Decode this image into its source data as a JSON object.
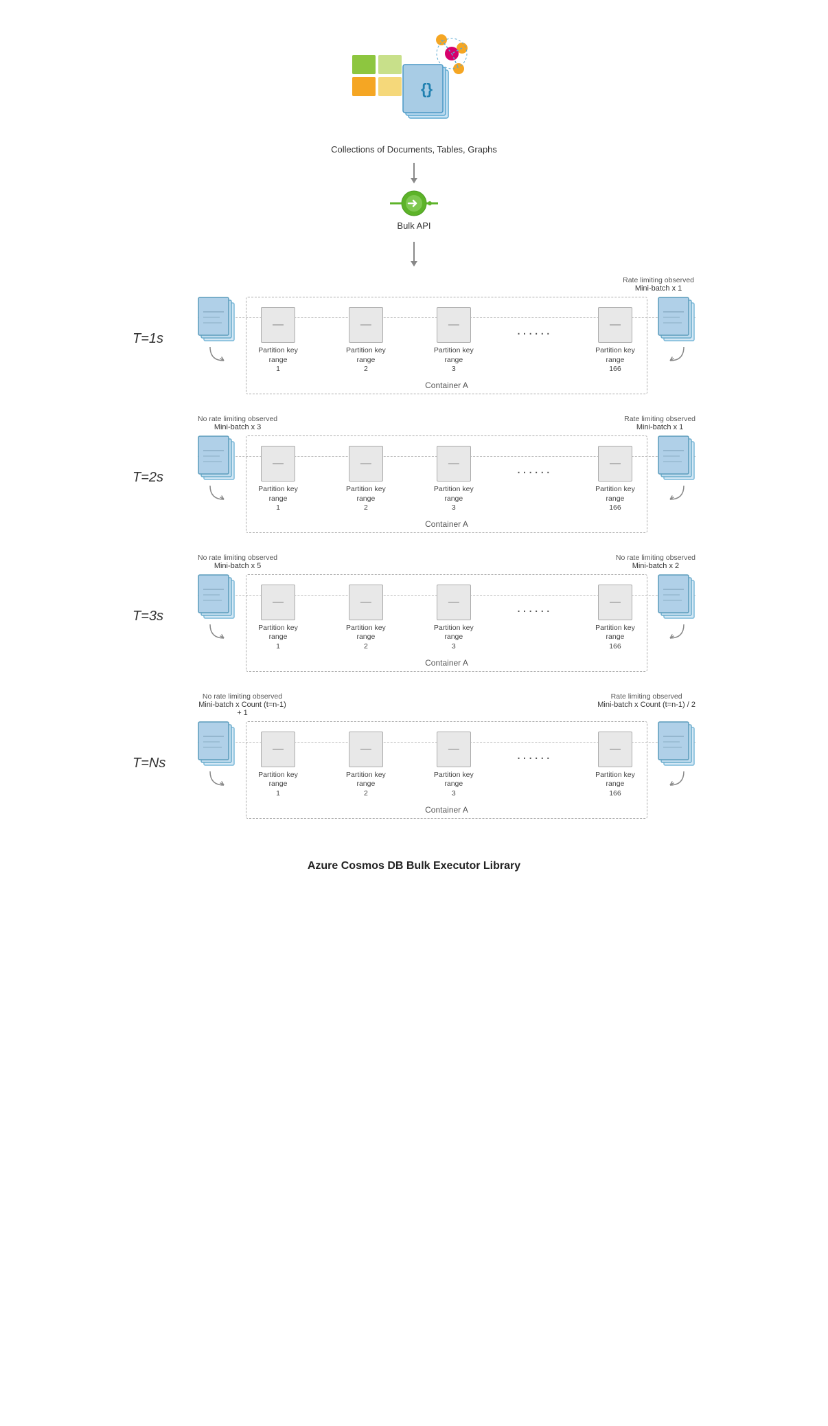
{
  "page": {
    "title": "Azure Cosmos DB Bulk Executor Library",
    "top_caption": "Collections of Documents, Tables, Graphs",
    "bulk_api_label": "Bulk API",
    "container_label": "Container A",
    "ellipsis": "......",
    "sections": [
      {
        "id": "t1",
        "time_label": "T=1s",
        "left_note": null,
        "left_batch": null,
        "right_note": "Rate limiting observed",
        "right_batch": "Mini-batch x 1",
        "partitions": [
          {
            "label": "Partition key range 1"
          },
          {
            "label": "Partition key range 2"
          },
          {
            "label": "Partition key range 3"
          },
          {
            "label": "Partition key range 166"
          }
        ]
      },
      {
        "id": "t2",
        "time_label": "T=2s",
        "left_note": "No rate limiting observed",
        "left_batch": "Mini-batch x 3",
        "right_note": "Rate limiting observed",
        "right_batch": "Mini-batch x 1",
        "partitions": [
          {
            "label": "Partition key range 1"
          },
          {
            "label": "Partition key range 2"
          },
          {
            "label": "Partition key range 3"
          },
          {
            "label": "Partition key range 166"
          }
        ]
      },
      {
        "id": "t3",
        "time_label": "T=3s",
        "left_note": "No rate limiting observed",
        "left_batch": "Mini-batch x 5",
        "right_note": "No rate limiting observed",
        "right_batch": "Mini-batch x 2",
        "partitions": [
          {
            "label": "Partition key range 1"
          },
          {
            "label": "Partition key range 2"
          },
          {
            "label": "Partition key range 3"
          },
          {
            "label": "Partition key range 166"
          }
        ]
      },
      {
        "id": "tN",
        "time_label": "T=Ns",
        "left_note": "No rate limiting observed",
        "left_batch": "Mini-batch x Count (t=n-1) + 1",
        "right_note": "Rate limiting observed",
        "right_batch": "Mini-batch x Count (t=n-1) / 2",
        "partitions": [
          {
            "label": "Partition key range 1"
          },
          {
            "label": "Partition key range 2"
          },
          {
            "label": "Partition key range 3"
          },
          {
            "label": "Partition key range 166"
          }
        ]
      }
    ]
  }
}
